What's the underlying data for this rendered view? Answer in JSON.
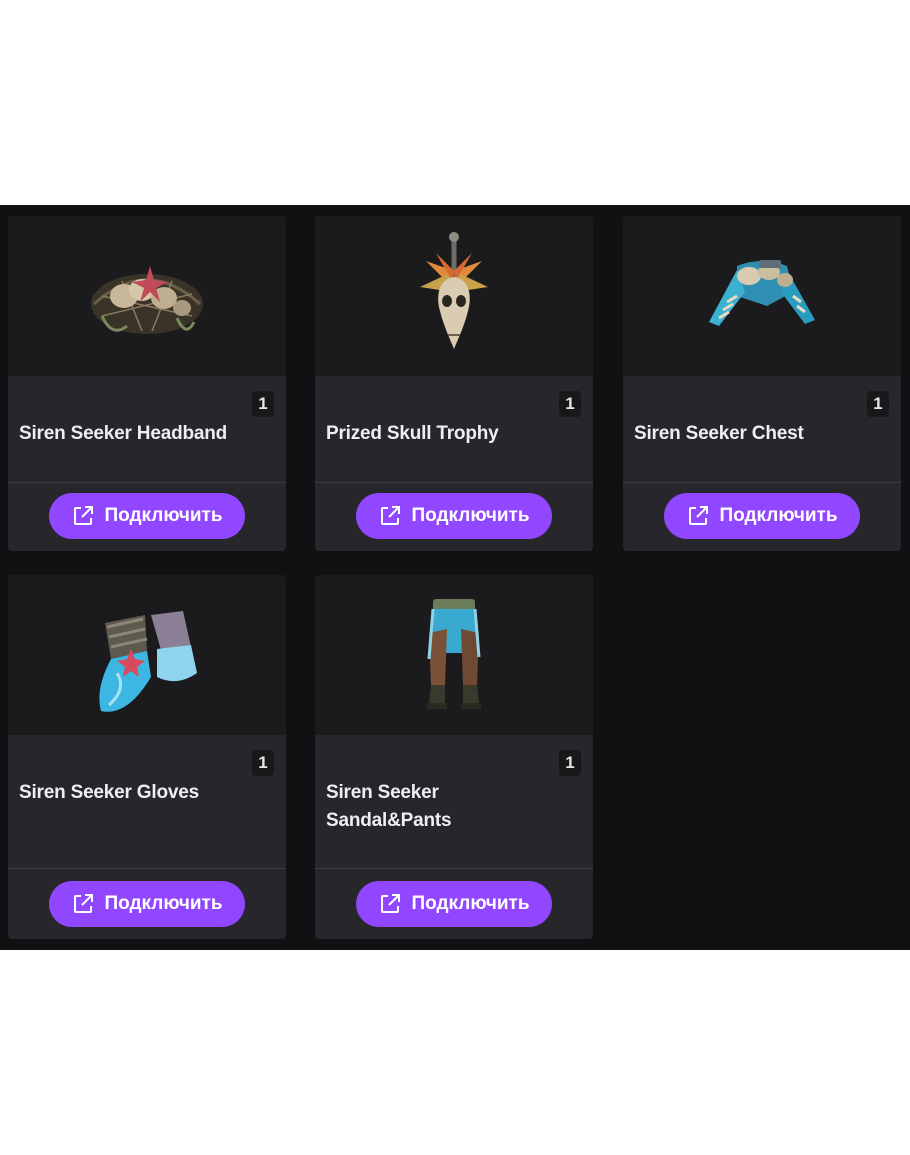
{
  "drops": {
    "items": [
      {
        "name": "Siren Seeker Headband",
        "quantity": "1",
        "button_label": "Подключить",
        "icon": "headband-icon"
      },
      {
        "name": "Prized Skull Trophy",
        "quantity": "1",
        "button_label": "Подключить",
        "icon": "skull-trophy-icon"
      },
      {
        "name": "Siren Seeker Chest",
        "quantity": "1",
        "button_label": "Подключить",
        "icon": "chest-armor-icon"
      },
      {
        "name": "Siren Seeker Gloves",
        "quantity": "1",
        "button_label": "Подключить",
        "icon": "gloves-icon"
      },
      {
        "name": "Siren Seeker Sandal&Pants",
        "quantity": "1",
        "button_label": "Подключить",
        "icon": "pants-icon"
      }
    ],
    "button_icon": "external-link-icon",
    "colors": {
      "panel_bg": "#111113",
      "card_bg": "#26262b",
      "image_bg": "#1b1b1e",
      "button": "#9147ff",
      "text": "#efeff1"
    }
  }
}
